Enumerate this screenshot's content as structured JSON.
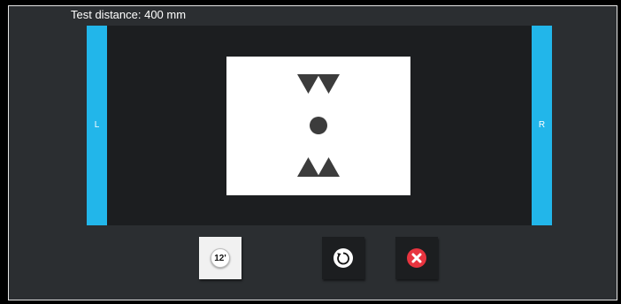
{
  "header": {
    "distance_label": "Test distance: 400 mm"
  },
  "stage": {
    "left_label": "L",
    "right_label": "R",
    "bar_color": "#22b6ea",
    "target_symbols": [
      "inverted-triangle-pair-icon",
      "dot-icon",
      "triangle-pair-icon"
    ]
  },
  "toolbar": {
    "angle_button_label": "12'",
    "rotate_icon": "rotate-icon",
    "close_icon": "close-icon",
    "close_color": "#e8343f"
  }
}
